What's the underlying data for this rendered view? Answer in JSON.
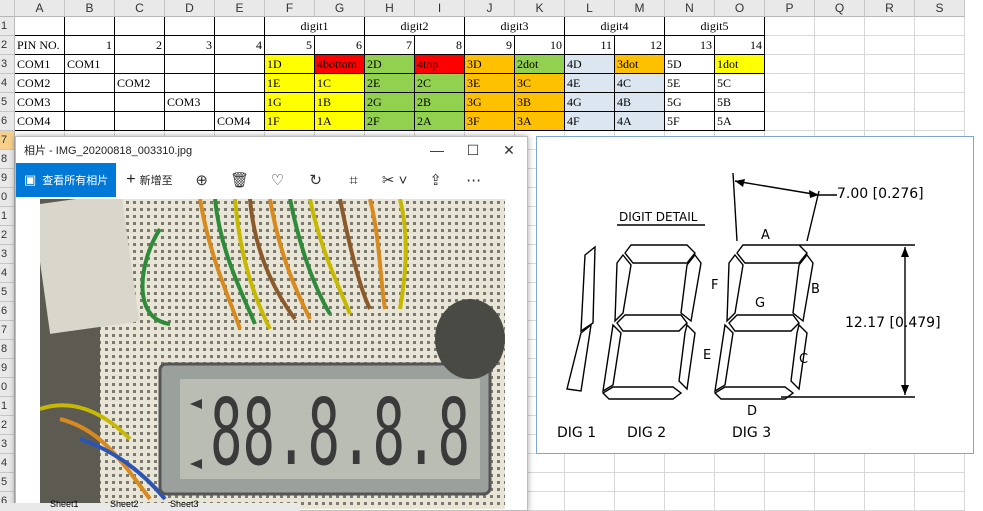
{
  "columns": [
    "A",
    "B",
    "C",
    "D",
    "E",
    "F",
    "G",
    "H",
    "I",
    "J",
    "K",
    "L",
    "M",
    "N",
    "O",
    "P",
    "Q",
    "R",
    "S"
  ],
  "rows": [
    "1",
    "2",
    "3",
    "4",
    "5",
    "6",
    "7",
    "8",
    "9",
    "0",
    "1",
    "2",
    "3",
    "4",
    "5",
    "6",
    "7",
    "8",
    "9",
    "0",
    "1",
    "2",
    "3",
    "4",
    "5",
    "6"
  ],
  "spreadsheet": {
    "digit_headers": [
      "digit1",
      "digit2",
      "digit3",
      "digit4",
      "digit5"
    ],
    "pin_label": "PIN NO.",
    "pin_numbers": [
      "1",
      "2",
      "3",
      "4",
      "5",
      "6",
      "7",
      "8",
      "9",
      "10",
      "11",
      "12",
      "13",
      "14"
    ],
    "com_labels": [
      "COM1",
      "COM2",
      "COM3",
      "COM4"
    ],
    "com_diag": [
      "COM1",
      "COM2",
      "COM3",
      "COM4"
    ],
    "segments": [
      [
        "1D",
        "4bottom",
        "2D",
        "4top",
        "3D",
        "2dot",
        "4D",
        "3dot",
        "5D",
        "1dot"
      ],
      [
        "1E",
        "1C",
        "2E",
        "2C",
        "3E",
        "3C",
        "4E",
        "4C",
        "5E",
        "5C"
      ],
      [
        "1G",
        "1B",
        "2G",
        "2B",
        "3G",
        "3B",
        "4G",
        "4B",
        "5G",
        "5B"
      ],
      [
        "1F",
        "1A",
        "2F",
        "2A",
        "3F",
        "3A",
        "4F",
        "4A",
        "5F",
        "5A"
      ]
    ]
  },
  "photos_window": {
    "title": "相片 - IMG_20200818_003310.jpg",
    "view_all": "查看所有相片",
    "add_to": "新增至",
    "controls": [
      "minimize",
      "maximize",
      "close"
    ]
  },
  "diagram": {
    "title": "DIGIT DETAIL",
    "width_dim": "7.00 [0.276]",
    "height_dim": "12.17 [0.479]",
    "segment_labels": [
      "A",
      "B",
      "C",
      "D",
      "E",
      "F",
      "G"
    ],
    "digit_labels": [
      "DIG 1",
      "DIG 2",
      "DIG 3"
    ]
  },
  "lcd_text": "88.8.8.8",
  "sheet_tabs": [
    "Sheet1",
    "Sheet2",
    "Sheet3"
  ]
}
